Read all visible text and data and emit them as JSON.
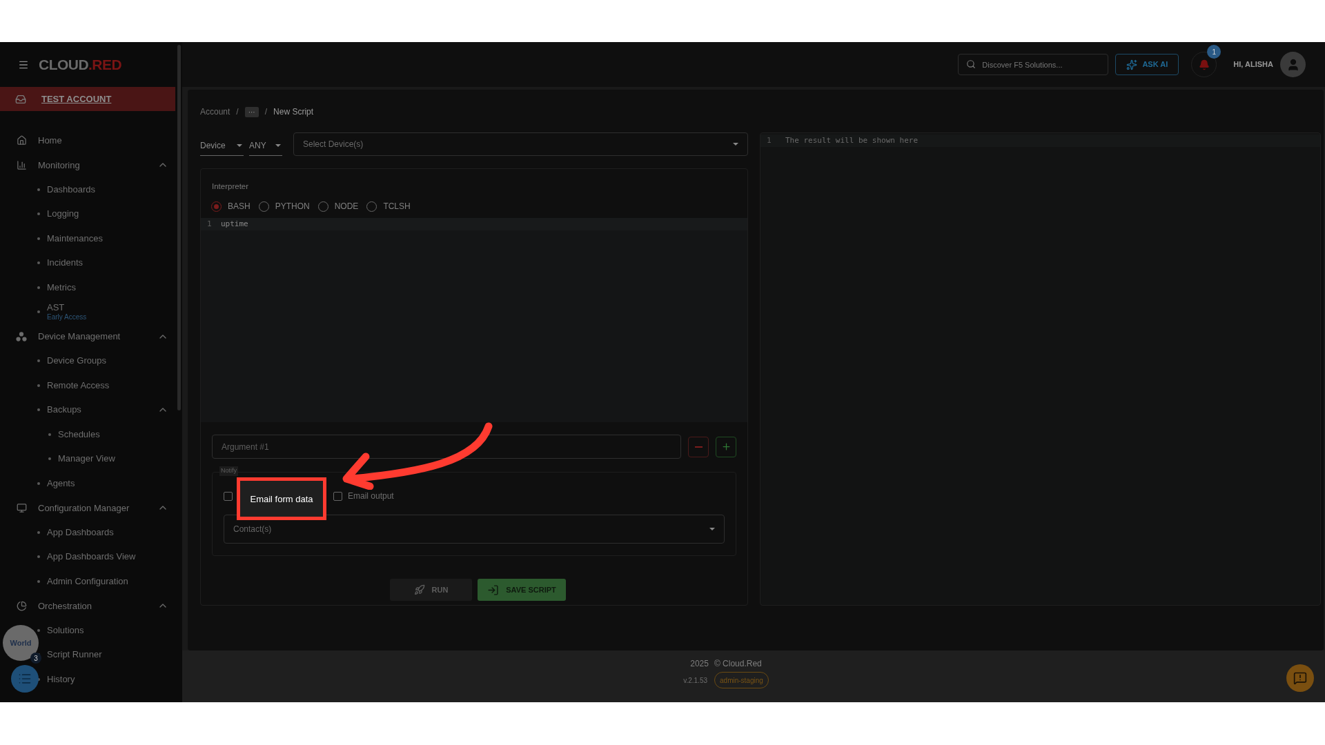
{
  "sidebar": {
    "logo": {
      "left": "CLOUD",
      "right": ".RED"
    },
    "account": "TEST ACCOUNT",
    "items": [
      {
        "label": "Home"
      },
      {
        "label": "Monitoring",
        "expanded": true,
        "children": [
          {
            "label": "Dashboards"
          },
          {
            "label": "Logging"
          },
          {
            "label": "Maintenances"
          },
          {
            "label": "Incidents"
          },
          {
            "label": "Metrics"
          },
          {
            "label": "AST",
            "badge": "Early Access"
          }
        ]
      },
      {
        "label": "Device Management",
        "expanded": true,
        "children": [
          {
            "label": "Device Groups"
          },
          {
            "label": "Remote Access"
          },
          {
            "label": "Backups",
            "expanded": true,
            "children": [
              {
                "label": "Schedules"
              },
              {
                "label": "Manager View"
              }
            ]
          },
          {
            "label": "Agents"
          }
        ]
      },
      {
        "label": "Configuration Manager",
        "expanded": true,
        "children": [
          {
            "label": "App Dashboards"
          },
          {
            "label": "App Dashboards View"
          },
          {
            "label": "Admin Configuration"
          }
        ]
      },
      {
        "label": "Orchestration",
        "expanded": true,
        "children": [
          {
            "label": "Solutions"
          },
          {
            "label": "Script Runner"
          },
          {
            "label": "History"
          }
        ]
      }
    ]
  },
  "floating_widget": {
    "logo": "World",
    "count": "3"
  },
  "header": {
    "search": {
      "placeholder": "Discover F5 Solutions..."
    },
    "ask_ai": "ASK AI",
    "notifications": "1",
    "greeting": "HI, ALISHA"
  },
  "breadcrumb": [
    {
      "label": "Account",
      "kind": "link"
    },
    {
      "label": "···",
      "kind": "more",
      "separator": "/"
    },
    {
      "label": "New Script",
      "kind": "current",
      "separator": "/"
    }
  ],
  "filters": {
    "target": "Device",
    "match": "ANY",
    "devices": {
      "placeholder": "Select Device(s)"
    }
  },
  "interpreter": {
    "label": "Interpreter",
    "options": [
      {
        "label": "BASH",
        "selected": true
      },
      {
        "label": "PYTHON",
        "selected": false
      },
      {
        "label": "NODE",
        "selected": false
      },
      {
        "label": "TCLSH",
        "selected": false
      }
    ]
  },
  "editor": {
    "lines": [
      {
        "number": "1",
        "text": "uptime"
      }
    ]
  },
  "argument": {
    "placeholder": "Argument #1"
  },
  "notify": {
    "legend": "Notify",
    "checkboxes": [
      {
        "tooltip": "Email form data",
        "checked": false
      },
      {
        "label": "Email output",
        "checked": false
      }
    ],
    "contacts": {
      "placeholder": "Contact(s)"
    }
  },
  "actions": [
    {
      "label": "RUN",
      "disabled": true
    },
    {
      "label": "SAVE SCRIPT",
      "disabled": false
    }
  ],
  "result": {
    "lines": [
      {
        "number": "1",
        "text": "The result will be shown here"
      }
    ]
  },
  "footer": {
    "year": "2025",
    "copyright": "© Cloud.Red",
    "version": "v.2.1.53",
    "environment": "admin-staging"
  }
}
